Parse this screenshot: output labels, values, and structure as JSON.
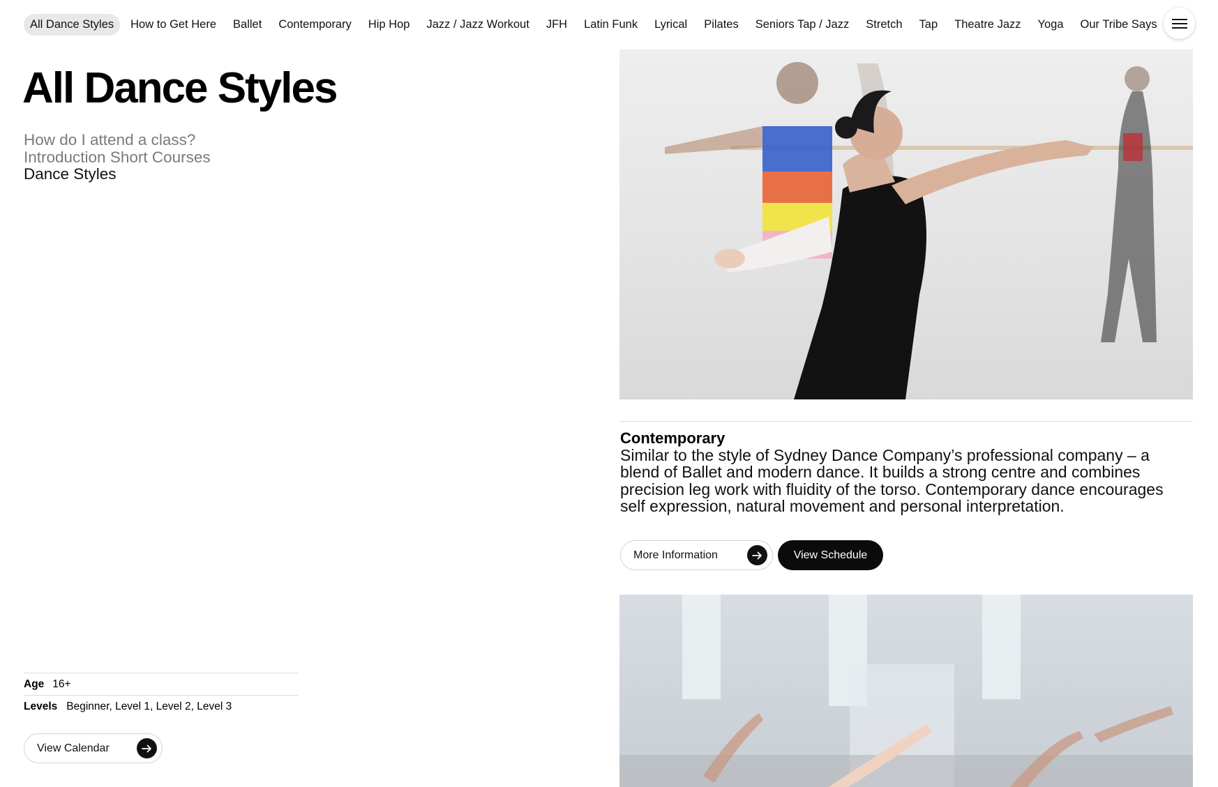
{
  "nav": {
    "items": [
      {
        "label": "All Dance Styles",
        "active": true
      },
      {
        "label": "How to Get Here"
      },
      {
        "label": "Ballet"
      },
      {
        "label": "Contemporary"
      },
      {
        "label": "Hip Hop"
      },
      {
        "label": "Jazz / Jazz Workout"
      },
      {
        "label": "JFH"
      },
      {
        "label": "Latin Funk"
      },
      {
        "label": "Lyrical"
      },
      {
        "label": "Pilates"
      },
      {
        "label": "Seniors Tap / Jazz"
      },
      {
        "label": "Stretch"
      },
      {
        "label": "Tap"
      },
      {
        "label": "Theatre Jazz"
      },
      {
        "label": "Yoga"
      },
      {
        "label": "Our Tribe Says"
      }
    ],
    "menu_icon": "hamburger-menu-icon"
  },
  "page": {
    "title": "All Dance Styles",
    "subnav": [
      {
        "label": "How do I attend a class?"
      },
      {
        "label": "Introduction Short Courses"
      },
      {
        "label": "Dance Styles",
        "current": true
      }
    ]
  },
  "meta": {
    "age_label": "Age",
    "age_value": "16+",
    "levels_label": "Levels",
    "levels_value": "Beginner, Level 1, Level 2, Level 3"
  },
  "buttons": {
    "view_calendar": "View Calendar",
    "more_information": "More Information",
    "view_schedule": "View Schedule",
    "arrow_icon": "arrow-right-icon"
  },
  "feature": {
    "style_name": "Contemporary",
    "description": "Similar to the style of Sydney Dance Company’s professional company – a blend of Ballet and modern dance. It builds a strong centre and combines precision leg work with fluidity of the torso. Contemporary dance encourages self expression, natural movement and personal interpretation."
  },
  "colors": {
    "active_nav_bg": "#e8e8e8",
    "muted_text": "#7a7a7a",
    "dark_button": "#0b0b0b",
    "divider": "#dcdcdc"
  }
}
